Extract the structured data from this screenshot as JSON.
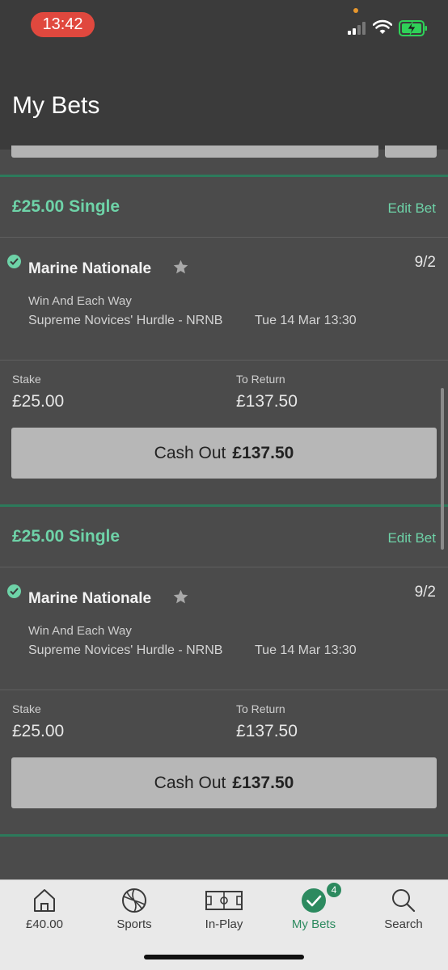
{
  "status_bar": {
    "time": "13:42"
  },
  "header": {
    "title": "My Bets"
  },
  "bets": [
    {
      "title": "£25.00 Single",
      "edit_label": "Edit Bet",
      "selection": "Marine Nationale",
      "odds": "9/2",
      "market": "Win And Each Way",
      "event": "Supreme Novices' Hurdle - NRNB",
      "event_time": "Tue 14 Mar 13:30",
      "stake_label": "Stake",
      "stake": "£25.00",
      "return_label": "To Return",
      "to_return": "£137.50",
      "cashout_label": "Cash Out",
      "cashout_amount": "£137.50"
    },
    {
      "title": "£25.00 Single",
      "edit_label": "Edit Bet",
      "selection": "Marine Nationale",
      "odds": "9/2",
      "market": "Win And Each Way",
      "event": "Supreme Novices' Hurdle - NRNB",
      "event_time": "Tue 14 Mar 13:30",
      "stake_label": "Stake",
      "stake": "£25.00",
      "return_label": "To Return",
      "to_return": "£137.50",
      "cashout_label": "Cash Out",
      "cashout_amount": "£137.50"
    }
  ],
  "nav": {
    "items": [
      {
        "label": "£40.00",
        "icon": "home-icon"
      },
      {
        "label": "Sports",
        "icon": "football-icon"
      },
      {
        "label": "In-Play",
        "icon": "pitch-icon"
      },
      {
        "label": "My Bets",
        "icon": "checkmark-icon",
        "badge": "4"
      },
      {
        "label": "Search",
        "icon": "search-icon"
      }
    ]
  },
  "colors": {
    "accent": "#6ed3a8",
    "active_nav": "#2c8a5f",
    "status_time_bg": "#e0483e"
  }
}
